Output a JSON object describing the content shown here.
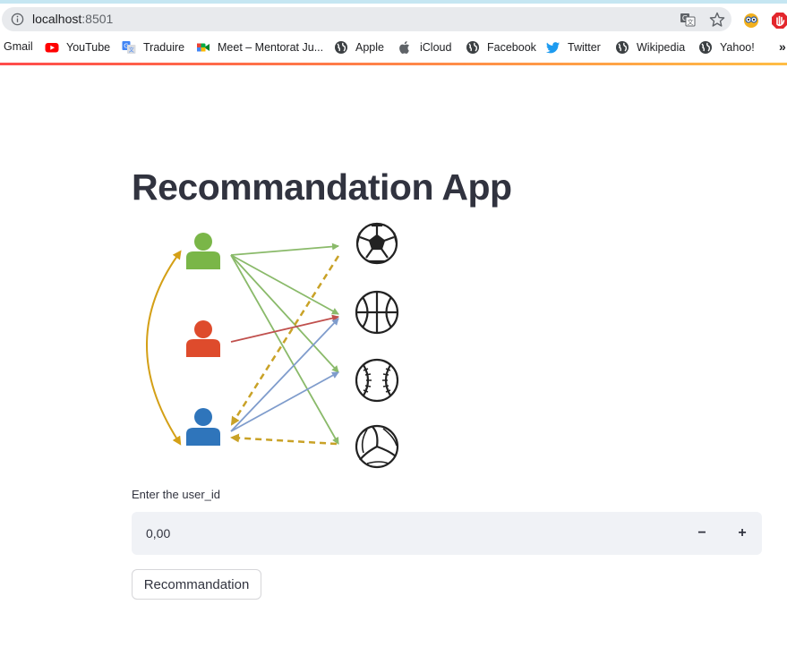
{
  "browser": {
    "url_host": "localhost",
    "url_port": ":8501",
    "bookmarks": [
      {
        "label": "Gmail",
        "icon": "gmail-icon"
      },
      {
        "label": "YouTube",
        "icon": "youtube-icon"
      },
      {
        "label": "Traduire",
        "icon": "translate-icon"
      },
      {
        "label": "Meet – Mentorat Ju...",
        "icon": "meet-icon"
      },
      {
        "label": "Apple",
        "icon": "globe-icon"
      },
      {
        "label": "iCloud",
        "icon": "apple-icon"
      },
      {
        "label": "Facebook",
        "icon": "globe-icon"
      },
      {
        "label": "Twitter",
        "icon": "twitter-icon"
      },
      {
        "label": "Wikipedia",
        "icon": "globe-icon"
      },
      {
        "label": "Yahoo!",
        "icon": "globe-icon"
      }
    ],
    "more": "»"
  },
  "app": {
    "title": "Recommandation App",
    "diagram_icons": [
      "user-green-icon",
      "user-red-icon",
      "user-blue-icon",
      "soccer-ball-icon",
      "basketball-icon",
      "baseball-icon",
      "volleyball-icon"
    ],
    "input_label": "Enter the user_id",
    "input_value": "0,00",
    "minus_label": "−",
    "plus_label": "+",
    "button_label": "Recommandation"
  },
  "colors": {
    "accent_red": "#ff4b4b",
    "accent_orange": "#ffbd45",
    "user_green": "#7ab648",
    "user_red": "#de4b2c",
    "user_blue": "#2f75bb",
    "arrow_gold": "#d4a017"
  }
}
